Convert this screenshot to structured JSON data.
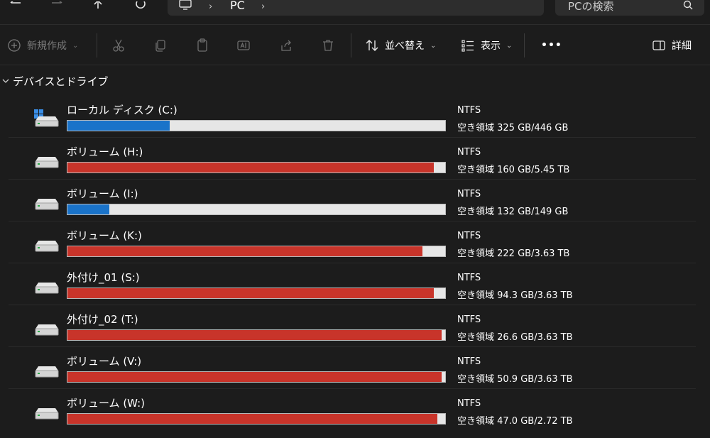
{
  "address": {
    "crumb": "PC",
    "separator": "›"
  },
  "search": {
    "placeholder": "PCの検索"
  },
  "toolbar": {
    "new_label": "新規作成",
    "sort_label": "並べ替え",
    "view_label": "表示",
    "more_label": "•••",
    "details_label": "詳細"
  },
  "section": {
    "title": "デバイスとドライブ"
  },
  "colors": {
    "normal": "#1a73c9",
    "warning": "#c8342a"
  },
  "drives": [
    {
      "name": "ローカル ディスク (C:)",
      "fs": "NTFS",
      "free_label": "空き領域 325 GB/446 GB",
      "used_fraction": 0.27,
      "state": "normal",
      "icon": "windows-drive-icon"
    },
    {
      "name": "ボリューム (H:)",
      "fs": "NTFS",
      "free_label": "空き領域 160 GB/5.45 TB",
      "used_fraction": 0.97,
      "state": "warning",
      "icon": "drive-icon"
    },
    {
      "name": "ボリューム (I:)",
      "fs": "NTFS",
      "free_label": "空き領域 132 GB/149 GB",
      "used_fraction": 0.11,
      "state": "normal",
      "icon": "drive-icon"
    },
    {
      "name": "ボリューム (K:)",
      "fs": "NTFS",
      "free_label": "空き領域 222 GB/3.63 TB",
      "used_fraction": 0.94,
      "state": "warning",
      "icon": "drive-icon"
    },
    {
      "name": "外付け_01 (S:)",
      "fs": "NTFS",
      "free_label": "空き領域 94.3 GB/3.63 TB",
      "used_fraction": 0.97,
      "state": "warning",
      "icon": "drive-icon"
    },
    {
      "name": "外付け_02 (T:)",
      "fs": "NTFS",
      "free_label": "空き領域 26.6 GB/3.63 TB",
      "used_fraction": 0.99,
      "state": "warning",
      "icon": "drive-icon"
    },
    {
      "name": "ボリューム (V:)",
      "fs": "NTFS",
      "free_label": "空き領域 50.9 GB/3.63 TB",
      "used_fraction": 0.99,
      "state": "warning",
      "icon": "drive-icon"
    },
    {
      "name": "ボリューム (W:)",
      "fs": "NTFS",
      "free_label": "空き領域 47.0 GB/2.72 TB",
      "used_fraction": 0.98,
      "state": "warning",
      "icon": "drive-icon"
    }
  ]
}
